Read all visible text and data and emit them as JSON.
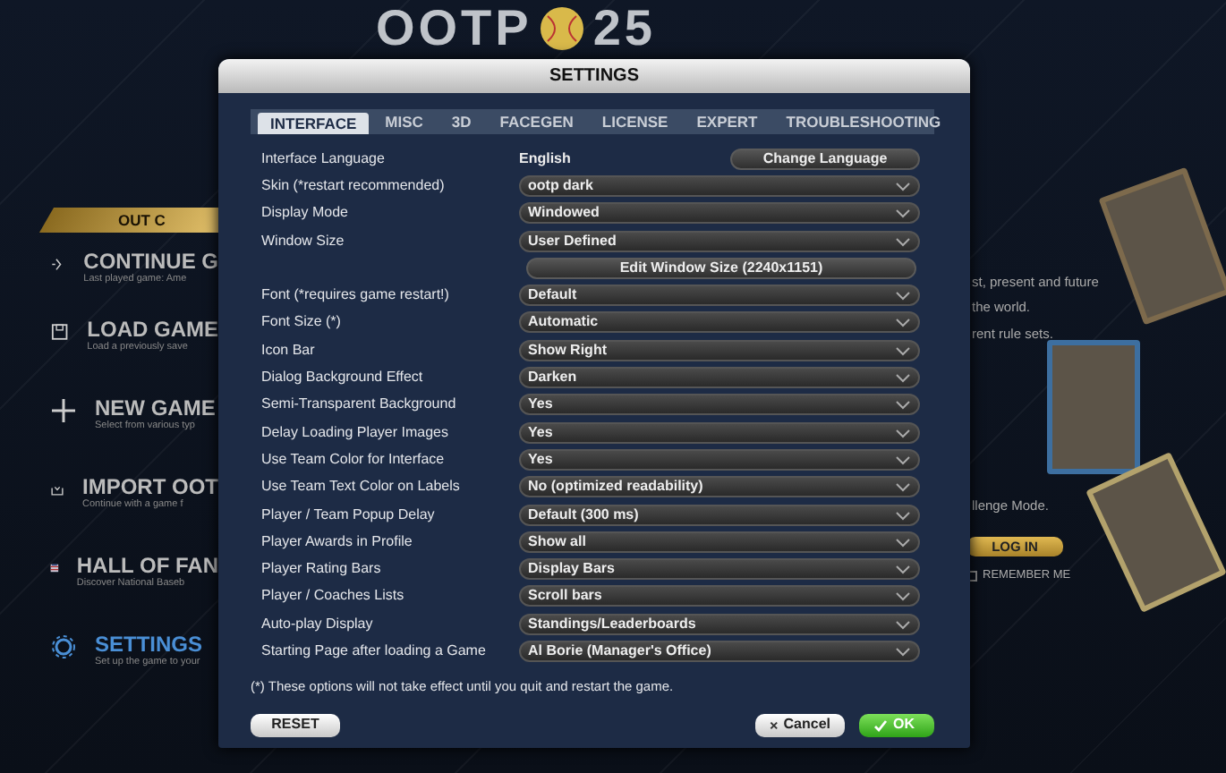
{
  "background": {
    "logo": {
      "text": "OOTP",
      "number": "25"
    },
    "banner": "OUT C",
    "menu": [
      {
        "kind": "continue",
        "title": "CONTINUE G",
        "subtitle": "Last played game: Ame",
        "selected": false
      },
      {
        "kind": "load",
        "title": "LOAD GAME",
        "subtitle": "Load a previously save",
        "selected": false
      },
      {
        "kind": "new",
        "title": "NEW GAME",
        "subtitle": "Select from various typ",
        "selected": false
      },
      {
        "kind": "import",
        "title": "IMPORT OOT",
        "subtitle": "Continue with a game f",
        "selected": false
      },
      {
        "kind": "hall",
        "title": "HALL OF FAN",
        "subtitle": "Discover National Baseb",
        "selected": false
      },
      {
        "kind": "settings",
        "title": "SETTINGS",
        "subtitle": "Set up the game to your",
        "selected": true
      }
    ],
    "promo_lines": [
      "st, present and future",
      "the world.",
      "rent rule sets."
    ],
    "promo_end": "llenge Mode.",
    "login_button": "LOG IN",
    "remember_me": {
      "label": "REMEMBER ME",
      "checked": false
    }
  },
  "dialog": {
    "title": "SETTINGS",
    "tabs": [
      {
        "label": "INTERFACE",
        "selected": true
      },
      {
        "label": "MISC",
        "selected": false
      },
      {
        "label": "3D",
        "selected": false
      },
      {
        "label": "FACEGEN",
        "selected": false
      },
      {
        "label": "LICENSE",
        "selected": false
      },
      {
        "label": "EXPERT",
        "selected": false
      },
      {
        "label": "TROUBLESHOOTING",
        "selected": false
      }
    ],
    "settings": [
      {
        "kind": "text",
        "label": "Interface Language",
        "value": "English",
        "button": "Change Language"
      },
      {
        "kind": "select",
        "label": "Skin (*restart recommended)",
        "value": "ootp dark"
      },
      {
        "kind": "select",
        "label": "Display Mode",
        "value": "Windowed"
      },
      {
        "kind": "select",
        "label": "Window Size",
        "value": "User Defined"
      },
      {
        "kind": "button",
        "value": "Edit Window Size (2240x1151)"
      },
      {
        "kind": "select",
        "label": "Font (*requires game restart!)",
        "value": "Default"
      },
      {
        "kind": "select",
        "label": "Font Size (*)",
        "value": "Automatic"
      },
      {
        "kind": "select",
        "label": "Icon Bar",
        "value": "Show Right"
      },
      {
        "kind": "select",
        "label": "Dialog Background Effect",
        "value": "Darken"
      },
      {
        "kind": "select",
        "label": "Semi-Transparent Background",
        "value": "Yes"
      },
      {
        "kind": "select",
        "label": "Delay Loading Player Images",
        "value": "Yes"
      },
      {
        "kind": "select",
        "label": "Use Team Color for Interface",
        "value": "Yes"
      },
      {
        "kind": "select",
        "label": "Use Team Text Color on Labels",
        "value": "No (optimized readability)"
      },
      {
        "kind": "select",
        "label": "Player / Team Popup Delay",
        "value": "Default (300 ms)"
      },
      {
        "kind": "select",
        "label": "Player Awards in Profile",
        "value": "Show all"
      },
      {
        "kind": "select",
        "label": "Player Rating Bars",
        "value": "Display Bars"
      },
      {
        "kind": "select",
        "label": "Player / Coaches Lists",
        "value": "Scroll bars"
      },
      {
        "kind": "select",
        "label": "Auto-play Display",
        "value": "Standings/Leaderboards"
      },
      {
        "kind": "select",
        "label": "Starting Page after loading a Game",
        "value": "Al Borie (Manager's Office)"
      }
    ],
    "footnote": "(*) These options will not take effect until you quit and restart the game.",
    "reset": "RESET",
    "cancel": "Cancel",
    "ok": "OK"
  }
}
